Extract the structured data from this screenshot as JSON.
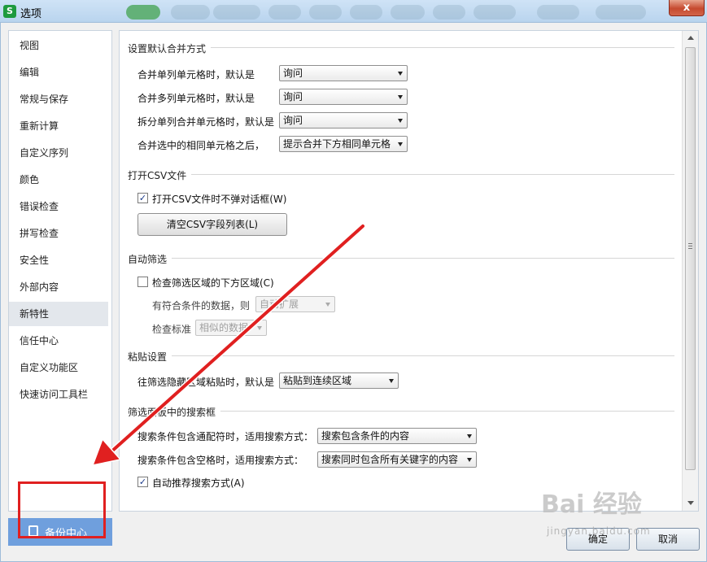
{
  "window": {
    "title": "选项",
    "close_label": "x",
    "app_icon": "S"
  },
  "sidebar": {
    "items": [
      {
        "label": "视图"
      },
      {
        "label": "编辑"
      },
      {
        "label": "常规与保存"
      },
      {
        "label": "重新计算"
      },
      {
        "label": "自定义序列"
      },
      {
        "label": "颜色"
      },
      {
        "label": "错误检查"
      },
      {
        "label": "拼写检查"
      },
      {
        "label": "安全性"
      },
      {
        "label": "外部内容"
      },
      {
        "label": "新特性",
        "active": true
      },
      {
        "label": "信任中心"
      },
      {
        "label": "自定义功能区"
      },
      {
        "label": "快速访问工具栏"
      }
    ],
    "backup_label": "备份中心"
  },
  "merge": {
    "title": "设置默认合并方式",
    "rows": [
      {
        "label": "合并单列单元格时，默认是",
        "value": "询问"
      },
      {
        "label": "合并多列单元格时，默认是",
        "value": "询问"
      },
      {
        "label": "拆分单列合并单元格时，默认是",
        "value": "询问"
      },
      {
        "label": "合并选中的相同单元格之后，",
        "value": "提示合并下方相同单元格"
      }
    ]
  },
  "csv": {
    "title": "打开CSV文件",
    "checkbox_label": "打开CSV文件时不弹对话框(W)",
    "checked": true,
    "clear_button": "清空CSV字段列表(L)"
  },
  "filter": {
    "title": "自动筛选",
    "checkbox_label": "检查筛选区域的下方区域(C)",
    "checked": false,
    "data_label": "有符合条件的数据，则",
    "data_value": "自动扩展",
    "criteria_label": "检查标准",
    "criteria_value": "相似的数据"
  },
  "paste": {
    "title": "粘贴设置",
    "label": "往筛选隐藏区域粘贴时，默认是",
    "value": "粘贴到连续区域"
  },
  "search": {
    "title": "筛选面板中的搜索框",
    "rows": [
      {
        "label": "搜索条件包含通配符时，适用搜索方式：",
        "value": "搜索包含条件的内容"
      },
      {
        "label": "搜索条件包含空格时，适用搜索方式：",
        "value": "搜索同时包含所有关键字的内容"
      }
    ],
    "auto_label": "自动推荐搜索方式(A)",
    "auto_checked": true
  },
  "footer": {
    "ok_label": "确定",
    "cancel_label": "取消"
  },
  "watermark": {
    "main": "Bai 经验",
    "sub": "jingyan.baidu.com"
  },
  "colors": {
    "accent": "#6f9fdd",
    "highlight": "#e02020",
    "arrow": "#e02020"
  }
}
